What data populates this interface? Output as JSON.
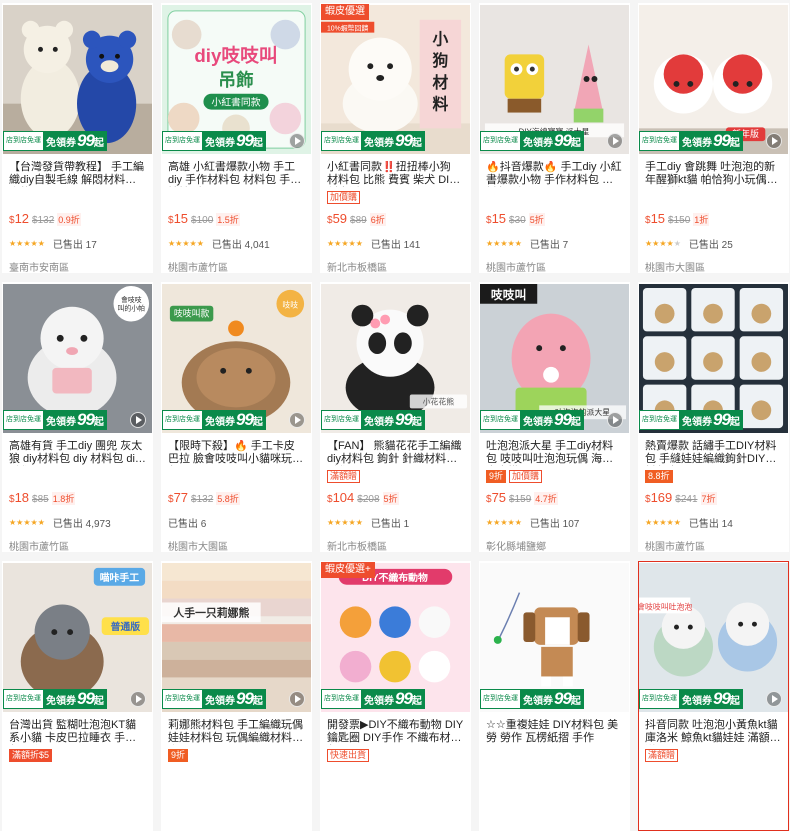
{
  "coupon": {
    "line1": "店到店免運",
    "line2": "免領券",
    "amount": "99",
    "unit": "起"
  },
  "products": [
    {
      "title": "【台灣發貨帶教程】 手工編織diy自製毛線 解悶材料包小熊...",
      "tags": [],
      "price": "12",
      "orig": "$132",
      "disc": "0.9折",
      "stars": 5,
      "sold": "已售出 17",
      "loc": "臺南市安南區",
      "top_badge": "",
      "video": false,
      "img": "bears"
    },
    {
      "title": "高雄 小紅書爆款小物 手工diy 手作材料包 材料包 手作娃娃 吱...",
      "tags": [],
      "price": "15",
      "orig": "$100",
      "disc": "1.5折",
      "stars": 5,
      "sold": "已售出 4,041",
      "loc": "桃園市蘆竹區",
      "top_badge": "",
      "video": true,
      "img": "squeak"
    },
    {
      "title": "小紅書同款‼️扭扭棒小狗 材料包 比熊 費賓 柴犬 DIY創意活...",
      "tags": [
        {
          "t": "加價購",
          "cls": ""
        }
      ],
      "price": "59",
      "orig": "$89",
      "disc": "6折",
      "stars": 5,
      "sold": "已售出 141",
      "loc": "新北市板橋區",
      "top_badge": "蝦皮優選",
      "video": false,
      "img": "dog"
    },
    {
      "title": "🔥抖音爆款🔥 手工diy 小紅書爆款小物 手作材料包 材料包 手...",
      "tags": [],
      "price": "15",
      "orig": "$30",
      "disc": "5折",
      "stars": 5,
      "sold": "已售出 7",
      "loc": "桃園市蘆竹區",
      "top_badge": "",
      "video": true,
      "img": "sponge"
    },
    {
      "title": "手工diy 會跳舞 吐泡泡的新年醒獅kt貓 帕恰狗小玩偶 diy材料...",
      "tags": [],
      "price": "15",
      "orig": "$150",
      "disc": "1折",
      "stars": 4,
      "sold": "已售出 25",
      "loc": "桃園市大園區",
      "top_badge": "",
      "video": true,
      "img": "lion"
    },
    {
      "title": "高雄有貨 手工diy 團兜 灰太狼 diy材料包 diy 材料包 diy手作 ...",
      "tags": [],
      "price": "18",
      "orig": "$85",
      "disc": "1.8折",
      "stars": 5,
      "sold": "已售出 4,973",
      "loc": "桃園市蘆竹區",
      "top_badge": "",
      "video": true,
      "img": "wolf"
    },
    {
      "title": "【限時下殺】🔥 手工卡皮巴拉 臉會吱吱叫小貓咪玩偶包...",
      "tags": [],
      "price": "77",
      "orig": "$132",
      "disc": "5.8折",
      "stars": 0,
      "sold": "已售出 6",
      "loc": "桃園市大園區",
      "top_badge": "",
      "video": true,
      "img": "capy"
    },
    {
      "title": "【FAN】 熊貓花花手工編織diy材料包 鉤針 針織材料包 手作 ...",
      "tags": [
        {
          "t": "滿額贈",
          "cls": ""
        }
      ],
      "price": "104",
      "orig": "$208",
      "disc": "5折",
      "stars": 5,
      "sold": "已售出 1",
      "loc": "新北市板橋區",
      "top_badge": "",
      "video": false,
      "img": "panda"
    },
    {
      "title": "吐泡泡派大星 手工diy材料包 吱吱叫吐泡泡玩偶 海綿寶寶掛...",
      "tags": [
        {
          "t": "9折",
          "cls": "orange"
        },
        {
          "t": "加價購",
          "cls": ""
        }
      ],
      "price": "75",
      "orig": "$159",
      "disc": "4.7折",
      "stars": 5,
      "sold": "已售出 107",
      "loc": "彰化縣埔鹽鄉",
      "top_badge": "",
      "video": true,
      "img": "patrick"
    },
    {
      "title": "熱賣爆款 話繡手工DIY材料包 手縫娃娃編織鉤針DIY材料包十...",
      "tags": [
        {
          "t": "8.8折",
          "cls": "orange"
        }
      ],
      "price": "169",
      "orig": "$241",
      "disc": "7折",
      "stars": 5,
      "sold": "已售出 14",
      "loc": "桃園市蘆竹區",
      "top_badge": "",
      "video": false,
      "img": "zodiac"
    },
    {
      "title": "台灣出貨 監糊吐泡泡KT貓系小貓 卡皮巴拉睡衣 手作包 兩個...",
      "tags": [
        {
          "t": "滿額折$5",
          "cls": "fill"
        }
      ],
      "price": "",
      "orig": "",
      "disc": "",
      "stars": 0,
      "sold": "",
      "loc": "",
      "top_badge": "",
      "video": true,
      "img": "kitcapy"
    },
    {
      "title": "莉娜熊材料包 手工編織玩偶 娃娃材料包 玩偶編織材料包 小...",
      "tags": [
        {
          "t": "9折",
          "cls": "orange"
        }
      ],
      "price": "",
      "orig": "",
      "disc": "",
      "stars": 0,
      "sold": "",
      "loc": "",
      "top_badge": "",
      "video": true,
      "img": "fabric"
    },
    {
      "title": "開發票▶DIY不織布動物 DIY鑰匙圈 DIY手作 不織布材料包 不...",
      "tags": [
        {
          "t": "快速出貨",
          "cls": ""
        }
      ],
      "price": "",
      "orig": "",
      "disc": "",
      "stars": 0,
      "sold": "",
      "loc": "",
      "top_badge": "蝦皮優選+",
      "video": false,
      "img": "felt"
    },
    {
      "title": "☆☆重複娃娃 DIY材料包 美勞 勞作 瓦楞紙摺 手作",
      "tags": [],
      "price": "",
      "orig": "",
      "disc": "",
      "stars": 0,
      "sold": "",
      "loc": "",
      "top_badge": "",
      "video": false,
      "img": "beagle"
    },
    {
      "title": "抖音同款 吐泡泡小黃魚kt貓 庫洛米 鯨魚kt貓娃娃 滿額贈送...",
      "tags": [
        {
          "t": "滿額贈",
          "cls": ""
        }
      ],
      "price": "",
      "orig": "",
      "disc": "",
      "stars": 0,
      "sold": "",
      "loc": "",
      "top_badge": "",
      "video": true,
      "img": "kitty2"
    }
  ],
  "overlay_text": {
    "squeak_title": "diy吱吱叫",
    "squeak_sub": "吊飾",
    "squeak_tag": "小紅書同款",
    "dog_title": "扭扭棒小狗材料包",
    "dog_badge": "10%蝦幣回饋",
    "lion_tag": "新年版",
    "wolf_note": "會吱吱叫的小帕",
    "capy_tag": "吱吱叫款",
    "patrick_tag": "吱吱叫",
    "kit_tag": "喵咔手工",
    "kit_tag2": "普通版",
    "fabric_banner": "人手一只莉娜熊",
    "felt_title": "DIY不織布動物"
  },
  "colors": {
    "accent": "#ee4d2d",
    "coupon_green": "#0a8a4a",
    "star": "#f5a623"
  }
}
